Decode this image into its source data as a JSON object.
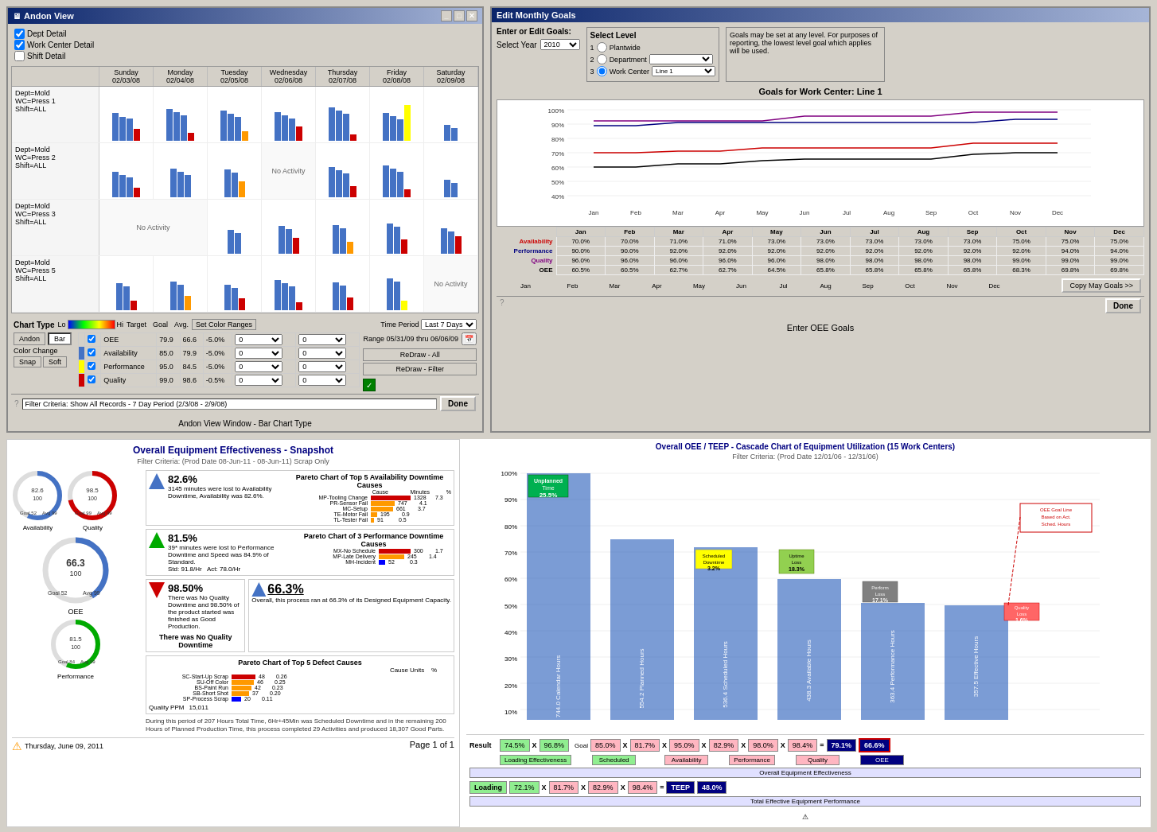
{
  "andon": {
    "title": "Andon View",
    "checkboxes": {
      "dept_detail": "Dept Detail",
      "work_center_detail": "Work Center Detail",
      "shift_detail": "Shift Detail"
    },
    "days": [
      {
        "day": "Sunday",
        "date": "02/03/08"
      },
      {
        "day": "Monday",
        "date": "02/04/08"
      },
      {
        "day": "Tuesday",
        "date": "02/05/08"
      },
      {
        "day": "Wednesday",
        "date": "02/06/08"
      },
      {
        "day": "Thursday",
        "date": "02/07/08"
      },
      {
        "day": "Friday",
        "date": "02/08/08"
      },
      {
        "day": "Saturday",
        "date": "02/09/08"
      }
    ],
    "rows": [
      {
        "dept": "Dept=Mold",
        "wc": "WC=Press 1",
        "shift": "Shift=ALL",
        "no_activity": []
      },
      {
        "dept": "Dept=Mold",
        "wc": "WC=Press 2",
        "shift": "Shift=ALL",
        "no_activity": [
          3
        ]
      },
      {
        "dept": "Dept=Mold",
        "wc": "WC=Press 3",
        "shift": "Shift=ALL",
        "no_activity": [
          0,
          1
        ]
      },
      {
        "dept": "Dept=Mold",
        "wc": "WC=Press 5",
        "shift": "Shift=ALL",
        "no_activity": [
          6
        ]
      }
    ],
    "controls": {
      "chart_type": "Chart Type",
      "lo": "Lo",
      "hi": "Hi",
      "target": "Target",
      "goal": "Goal",
      "avg": "Avg.",
      "set_color_ranges": "Set Color Ranges",
      "time_period": "Time Period",
      "last_7_days": "Last 7 Days",
      "andon": "Andon",
      "bar": "Bar",
      "color_change": "Color Change",
      "snap": "Snap",
      "soft": "Soft",
      "oee_label": "OEE",
      "availability": "Availability",
      "performance": "Performance",
      "quality": "Quality",
      "oee_val": "79.9",
      "avail_val": "85.0",
      "perf_val": "95.0",
      "qual_val": "99.0",
      "goal_val1": "66.6",
      "goal_val2": "79.9",
      "goal_val3": "84.5",
      "goal_val4": "98.6",
      "avg_val1": "-5.0%",
      "avg_val2": "-5.0%",
      "avg_val3": "-5.0%",
      "avg_val4": "-0.5%",
      "range_text": "Range 05/31/09 thru 06/06/09",
      "redraw_all": "ReDraw - All",
      "redraw_filter": "ReDraw - Filter",
      "filter_text": "Filter Criteria: Show All Records - 7 Day Period (2/3/08 - 2/9/08)",
      "done": "Done"
    }
  },
  "goals": {
    "title": "Edit Monthly Goals",
    "enter_label": "Enter or Edit Goals:",
    "select_year_label": "Select Year",
    "select_year_value": "2010",
    "select_level_title": "Select Level",
    "levels": [
      {
        "num": "1",
        "label": "Plantwide"
      },
      {
        "num": "2",
        "label": "Department"
      },
      {
        "num": "3",
        "label": "Work Center"
      }
    ],
    "wc_value": "Line 1",
    "info_text": "Goals may be set at any level. For purposes of reporting, the lowest level goal which applies will be used.",
    "goals_subtitle": "Goals for Work Center: Line 1",
    "months": [
      "Jan",
      "Feb",
      "Mar",
      "Apr",
      "May",
      "Jun",
      "Jul",
      "Aug",
      "Sep",
      "Oct",
      "Nov",
      "Dec"
    ],
    "rows": [
      {
        "label": "Availability",
        "color": "avail",
        "values": [
          "70.0%",
          "70.0%",
          "71.0%",
          "71.0%",
          "73.0%",
          "73.0%",
          "73.0%",
          "73.0%",
          "73.0%",
          "75.0%",
          "75.0%",
          "75.0%"
        ]
      },
      {
        "label": "Performance",
        "color": "perf",
        "values": [
          "90.0%",
          "90.0%",
          "92.0%",
          "92.0%",
          "92.0%",
          "92.0%",
          "92.0%",
          "92.0%",
          "92.0%",
          "92.0%",
          "94.0%",
          "94.0%"
        ]
      },
      {
        "label": "Quality",
        "color": "qual",
        "values": [
          "96.0%",
          "96.0%",
          "96.0%",
          "96.0%",
          "96.0%",
          "98.0%",
          "98.0%",
          "98.0%",
          "98.0%",
          "99.0%",
          "99.0%",
          "99.0%"
        ]
      },
      {
        "label": "OEE",
        "color": "oee",
        "values": [
          "60.5%",
          "60.5%",
          "62.7%",
          "62.7%",
          "64.5%",
          "65.8%",
          "65.8%",
          "65.8%",
          "65.8%",
          "68.3%",
          "69.8%",
          "69.8%"
        ]
      }
    ],
    "copy_btn": "Copy May Goals >>",
    "done": "Done",
    "caption": "Enter OEE Goals"
  },
  "snapshot": {
    "title": "Overall Equipment Effectiveness - Snapshot",
    "filter": "Filter Criteria: (Prod Date 08-Jun-11 - 08-Jun-11) Scrap Only",
    "availability": {
      "label": "Availability",
      "value": "82.6%",
      "desc": "3145 minutes were lost to Availability Downtime, Availability was 82.6%."
    },
    "performance": {
      "label": "Performance",
      "value": "81.5%",
      "desc": "39* minutes were lost to Performance Downtime and Speed was 84.9% of Standard.",
      "std": "Std: 91.8/Hr",
      "act": "Act: 78.0/Hr"
    },
    "quality": {
      "label": "Quality",
      "value": "98.50%",
      "desc": "There was No Quality Downtime and 98.50% of the product started was finished as Good Production."
    },
    "oee": {
      "label": "OEE",
      "value": "66.3%",
      "desc": "Overall, this process ran at 66.3% of its Designed Equipment Capacity."
    },
    "gauges": {
      "availability": {
        "value": "82.6%",
        "label": "Availability"
      },
      "quality": {
        "value": "98.5%",
        "label": "Quality"
      },
      "oee": {
        "value": "66.3%",
        "label": "OEE"
      },
      "oee_center": {
        "value": "66.3 100",
        "label": "OEE"
      }
    },
    "quality_ppm": "15,011",
    "pareto_avail": [
      {
        "cause": "MP-Tooling Change",
        "min": 1328,
        "pct": 7.3
      },
      {
        "cause": "PR-Sensor Fail",
        "min": 747,
        "pct": 4.1
      },
      {
        "cause": "MC-Setup",
        "min": 661,
        "pct": 3.7
      },
      {
        "cause": "TE-Motor Fail",
        "min": 195,
        "pct": 0.9
      },
      {
        "cause": "TL-Tester Fail",
        "min": 91,
        "pct": 0.5
      }
    ],
    "pareto_perf": [
      {
        "cause": "MX-No Schedule",
        "min": 300,
        "pct": 1.7
      },
      {
        "cause": "MP-Late Delivery",
        "min": 245,
        "pct": 1.4
      },
      {
        "cause": "MH-Incident",
        "min": 52,
        "pct": 0.3
      }
    ],
    "pareto_defects": [
      {
        "cause": "SC-Start-Up Scrap",
        "min": 48,
        "pct": 0.26
      },
      {
        "cause": "SU-Off Color",
        "min": 46,
        "pct": 0.25
      },
      {
        "cause": "BS-Paint Run",
        "min": 42,
        "pct": 0.23
      },
      {
        "cause": "SB-Short Shot",
        "min": 37,
        "pct": 0.2
      },
      {
        "cause": "SP-Process Scrap",
        "min": 20,
        "pct": 0.11
      }
    ],
    "footer_date": "Thursday, June 09, 2011",
    "footer_page": "Page 1 of 1"
  },
  "teep": {
    "title": "Overall OEE / TEEP - Cascade Chart of Equipment Utilization (15 Work Centers)",
    "filter": "Filter Criteria: (Prod Date 12/01/06 - 12/31/06)",
    "bars": [
      {
        "label": "744.0 Calendar Hours",
        "color": "#4472c4",
        "height": 100,
        "pct": ""
      },
      {
        "label": "554.2 Planned Hours",
        "color": "#4472c4",
        "height": 74,
        "pct": ""
      },
      {
        "label": "536.4 Scheduled Hours",
        "color": "#4472c4",
        "height": 72,
        "pct": ""
      },
      {
        "label": "438.3 Available Hours",
        "color": "#4472c4",
        "height": 59,
        "pct": ""
      },
      {
        "label": "363.4 Performance Hours",
        "color": "#4472c4",
        "height": 49,
        "pct": ""
      },
      {
        "label": "357.5 Effective Hours",
        "color": "#4472c4",
        "height": 48,
        "pct": ""
      }
    ],
    "annotations": [
      {
        "label": "Unplanned Time",
        "value": "25.5%",
        "color": "#00b050"
      },
      {
        "label": "Scheduled Downtime",
        "value": "3.2%",
        "color": "#ffff00"
      },
      {
        "label": "Uptime Loss",
        "value": "18.3%",
        "color": "#92d050"
      },
      {
        "label": "Perform Loss",
        "value": "17.1%",
        "color": "#808080"
      },
      {
        "label": "Quality Loss",
        "value": "1.6%",
        "color": "#ff0000"
      },
      {
        "label": "OEE Goal Line Based on Act. Sched. Hours",
        "color": "#c00"
      }
    ],
    "result_oee": {
      "planned": "74.5%",
      "x1": "X",
      "scheduled": "96.8%",
      "goal": "Goal",
      "availability": "85.0%",
      "x2": "X",
      "availability_act": "81.7%",
      "x3": "X",
      "performance": "95.0%",
      "x4": "X",
      "performance_act": "82.9%",
      "x5": "X",
      "quality": "98.0%",
      "x6": "X",
      "quality_act": "98.4%",
      "equals": "=",
      "oee_goal": "79.1%",
      "oee_act": "66.6%",
      "loading": "Loading Effectiveness",
      "oee_label": "Overall Equipment Effectiveness"
    },
    "result_teep": {
      "loading": "Loading",
      "load_val": "72.1%",
      "x1": "X",
      "availability": "Availability",
      "avail_val": "81.7%",
      "x2": "X",
      "performance": "Performance",
      "perf_val": "82.9%",
      "x3": "X",
      "quality": "Quality",
      "qual_val": "98.4%",
      "equals": "=",
      "teep": "TEEP",
      "teep_val": "48.0%",
      "footer": "Total Effective Equipment Performance"
    }
  }
}
